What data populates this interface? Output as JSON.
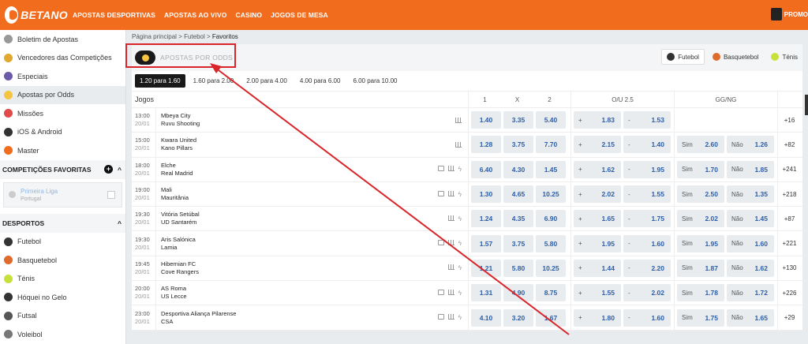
{
  "topbar": {
    "brand": "BETANO",
    "nav": [
      "APOSTAS DESPORTIVAS",
      "APOSTAS AO VIVO",
      "CASINO",
      "JOGOS DE MESA"
    ],
    "promo": "PROMO"
  },
  "sidebar": {
    "items": [
      {
        "label": "Boletim de Apostas",
        "icon": "betslip-icon",
        "color": "#999999"
      },
      {
        "label": "Vencedores das Competições",
        "icon": "trophy-icon",
        "color": "#e0a82e"
      },
      {
        "label": "Especiais",
        "icon": "medal-icon",
        "color": "#6b5ba8"
      },
      {
        "label": "Apostas por Odds",
        "icon": "odds-icon",
        "color": "#f5c542"
      },
      {
        "label": "Missões",
        "icon": "target-icon",
        "color": "#e04a4a"
      },
      {
        "label": "iOS & Android",
        "icon": "devices-icon",
        "color": "#333333"
      },
      {
        "label": "Master",
        "icon": "master-icon",
        "color": "#f26c1e"
      }
    ],
    "favorites_header": "COMPETIÇÕES FAVORITAS",
    "favorite": {
      "name": "Primeira Liga",
      "country": "Portugal"
    },
    "sports_header": "DESPORTOS",
    "sports": [
      {
        "label": "Futebol",
        "icon": "soccer-ball-icon",
        "color": "#333333"
      },
      {
        "label": "Basquetebol",
        "icon": "basketball-icon",
        "color": "#e06a2c"
      },
      {
        "label": "Ténis",
        "icon": "tennis-ball-icon",
        "color": "#c8e03a"
      },
      {
        "label": "Hóquei no Gelo",
        "icon": "hockey-icon",
        "color": "#333333"
      },
      {
        "label": "Futsal",
        "icon": "futsal-icon",
        "color": "#555555"
      },
      {
        "label": "Voleibol",
        "icon": "volleyball-icon",
        "color": "#777777"
      }
    ]
  },
  "breadcrumb": {
    "home": "Página principal",
    "sport": "Futebol",
    "current": "Favoritos"
  },
  "odds_section": {
    "title": "APOSTAS POR ODDS",
    "sports": [
      {
        "label": "Futebol",
        "color": "#333333"
      },
      {
        "label": "Basquetebol",
        "color": "#e06a2c"
      },
      {
        "label": "Ténis",
        "color": "#c8e03a"
      }
    ],
    "ranges": [
      "1.20 para 1.60",
      "1.60 para 2.00",
      "2.00 para 4.00",
      "4.00 para 6.00",
      "6.00 para 10.00"
    ]
  },
  "table": {
    "headers": {
      "games": "Jogos",
      "h1": "1",
      "hx": "X",
      "h2": "2",
      "ou": "O/U 2.5",
      "gg": "GG/NG"
    },
    "rows": [
      {
        "time": "13:00",
        "date": "20/01",
        "home": "Mbeya City",
        "away": "Ruvu Shooting",
        "tv": false,
        "live": false,
        "o1": "1.40",
        "ox": "3.35",
        "o2": "5.40",
        "over": "1.83",
        "under": "1.53",
        "sim": "",
        "nao": "",
        "more": "+16"
      },
      {
        "time": "15:00",
        "date": "20/01",
        "home": "Kwara United",
        "away": "Kano Pillars",
        "tv": false,
        "live": false,
        "o1": "1.28",
        "ox": "3.75",
        "o2": "7.70",
        "over": "2.15",
        "under": "1.40",
        "sim": "2.60",
        "nao": "1.26",
        "more": "+82"
      },
      {
        "time": "18:00",
        "date": "20/01",
        "home": "Elche",
        "away": "Real Madrid",
        "tv": true,
        "live": true,
        "o1": "6.40",
        "ox": "4.30",
        "o2": "1.45",
        "over": "1.62",
        "under": "1.95",
        "sim": "1.70",
        "nao": "1.85",
        "more": "+241"
      },
      {
        "time": "19:00",
        "date": "20/01",
        "home": "Mali",
        "away": "Mauritânia",
        "tv": true,
        "live": true,
        "o1": "1.30",
        "ox": "4.65",
        "o2": "10.25",
        "over": "2.02",
        "under": "1.55",
        "sim": "2.50",
        "nao": "1.35",
        "more": "+218"
      },
      {
        "time": "19:30",
        "date": "20/01",
        "home": "Vitória Setúbal",
        "away": "UD Santarém",
        "tv": false,
        "live": true,
        "o1": "1.24",
        "ox": "4.35",
        "o2": "6.90",
        "over": "1.65",
        "under": "1.75",
        "sim": "2.02",
        "nao": "1.45",
        "more": "+87"
      },
      {
        "time": "19:30",
        "date": "20/01",
        "home": "Aris Salónica",
        "away": "Lamia",
        "tv": true,
        "live": true,
        "o1": "1.57",
        "ox": "3.75",
        "o2": "5.80",
        "over": "1.95",
        "under": "1.60",
        "sim": "1.95",
        "nao": "1.60",
        "more": "+221"
      },
      {
        "time": "19:45",
        "date": "20/01",
        "home": "Hibernian FC",
        "away": "Cove Rangers",
        "tv": false,
        "live": true,
        "o1": "1.21",
        "ox": "5.80",
        "o2": "10.25",
        "over": "1.44",
        "under": "2.20",
        "sim": "1.87",
        "nao": "1.62",
        "more": "+130"
      },
      {
        "time": "20:00",
        "date": "20/01",
        "home": "AS Roma",
        "away": "US Lecce",
        "tv": true,
        "live": true,
        "o1": "1.31",
        "ox": "4.90",
        "o2": "8.75",
        "over": "1.55",
        "under": "2.02",
        "sim": "1.78",
        "nao": "1.72",
        "more": "+226"
      },
      {
        "time": "23:00",
        "date": "20/01",
        "home": "Desportiva Aliança Pilarense",
        "away": "CSA",
        "tv": true,
        "live": true,
        "o1": "4.10",
        "ox": "3.20",
        "o2": "1.67",
        "over": "1.80",
        "under": "1.60",
        "sim": "1.75",
        "nao": "1.65",
        "more": "+29"
      }
    ],
    "over_label": "+",
    "under_label": "-",
    "sim_label": "Sim",
    "nao_label": "Não"
  },
  "colors": {
    "brand": "#f26c1e",
    "odds_blue": "#2b5ea7",
    "annotation_red": "#d9252a"
  }
}
